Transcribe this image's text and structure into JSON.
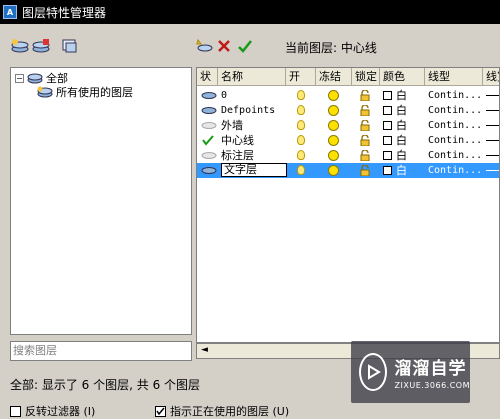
{
  "window": {
    "title": "图层特性管理器",
    "app_icon_text": "A"
  },
  "toolbar": {
    "current_layer_label": "当前图层: 中心线"
  },
  "tree": {
    "root_label": "全部",
    "child_label": "所有使用的图层"
  },
  "search": {
    "placeholder": "搜索图层"
  },
  "columns": [
    "状",
    "名称",
    "开",
    "冻结",
    "锁定",
    "颜色",
    "线型",
    "线宽"
  ],
  "layers": [
    {
      "status": "layer",
      "name": "0",
      "on": true,
      "frozen": false,
      "locked": false,
      "color": "白",
      "linetype": "Contin...",
      "selected": false
    },
    {
      "status": "layer",
      "name": "Defpoints",
      "on": true,
      "frozen": false,
      "locked": false,
      "color": "白",
      "linetype": "Contin...",
      "selected": false
    },
    {
      "status": "layer-empty",
      "name": "外墙",
      "on": true,
      "frozen": false,
      "locked": false,
      "color": "白",
      "linetype": "Contin...",
      "selected": false
    },
    {
      "status": "current",
      "name": "中心线",
      "on": true,
      "frozen": false,
      "locked": false,
      "color": "白",
      "linetype": "Contin...",
      "selected": false
    },
    {
      "status": "layer-empty",
      "name": "标注层",
      "on": true,
      "frozen": false,
      "locked": false,
      "color": "白",
      "linetype": "Contin...",
      "selected": false
    },
    {
      "status": "layer",
      "name": "文字层",
      "on": true,
      "frozen": false,
      "locked": false,
      "color": "白",
      "linetype": "Contin...",
      "selected": true
    }
  ],
  "status_bar": {
    "text": "全部: 显示了 6 个图层, 共 6 个图层"
  },
  "options": {
    "invert_filter": "反转过滤器 (I)",
    "show_used": "指示正在使用的图层 (U)"
  },
  "watermark": {
    "title": "溜溜自学",
    "subtitle": "ZIXUE.3066.COM"
  }
}
